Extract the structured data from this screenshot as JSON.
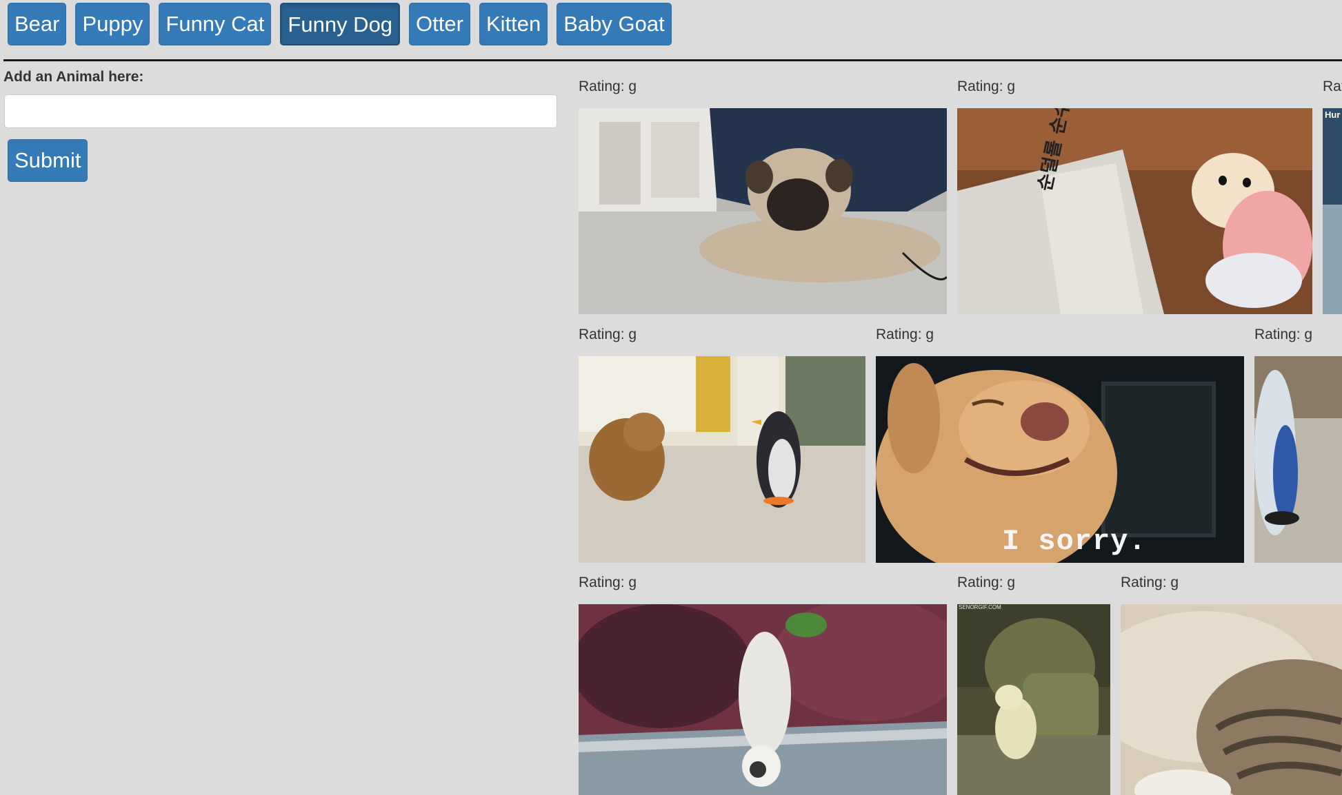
{
  "buttons": [
    {
      "label": "Bear"
    },
    {
      "label": "Puppy"
    },
    {
      "label": "Funny Cat"
    },
    {
      "label": "Funny Dog"
    },
    {
      "label": "Otter"
    },
    {
      "label": "Kitten"
    },
    {
      "label": "Baby Goat"
    }
  ],
  "active_button": "Funny Dog",
  "form": {
    "label": "Add an Animal here:",
    "input_value": "",
    "input_placeholder": "",
    "submit_label": "Submit"
  },
  "gifs": [
    {
      "rating": "Rating: g",
      "subject": "pug puppy lying on carpet"
    },
    {
      "rating": "Rating: g",
      "subject": "chihuahua holding newspaper",
      "overlay_text": "순덜룔 순수"
    },
    {
      "rating": "Rating: g",
      "subject": "partially visible gif",
      "overlay_text": "Hur"
    },
    {
      "rating": "Rating: g",
      "subject": "dachshund facing toy penguin"
    },
    {
      "rating": "Rating: g",
      "subject": "laughing dog",
      "overlay_text": "I sorry."
    },
    {
      "rating": "Rating: g",
      "subject": "partially visible gif"
    },
    {
      "rating": "Rating: g",
      "subject": "dog doing handstand by bushes"
    },
    {
      "rating": "Rating: g",
      "subject": "small dog sitting by armchair",
      "overlay_text": "SENORGIF.COM"
    },
    {
      "rating": "Rating: g",
      "subject": "cat lying on couch"
    }
  ],
  "colors": {
    "background": "#dcdcdc",
    "button": "#337ab7",
    "button_active": "#286090",
    "text": "#333333"
  }
}
